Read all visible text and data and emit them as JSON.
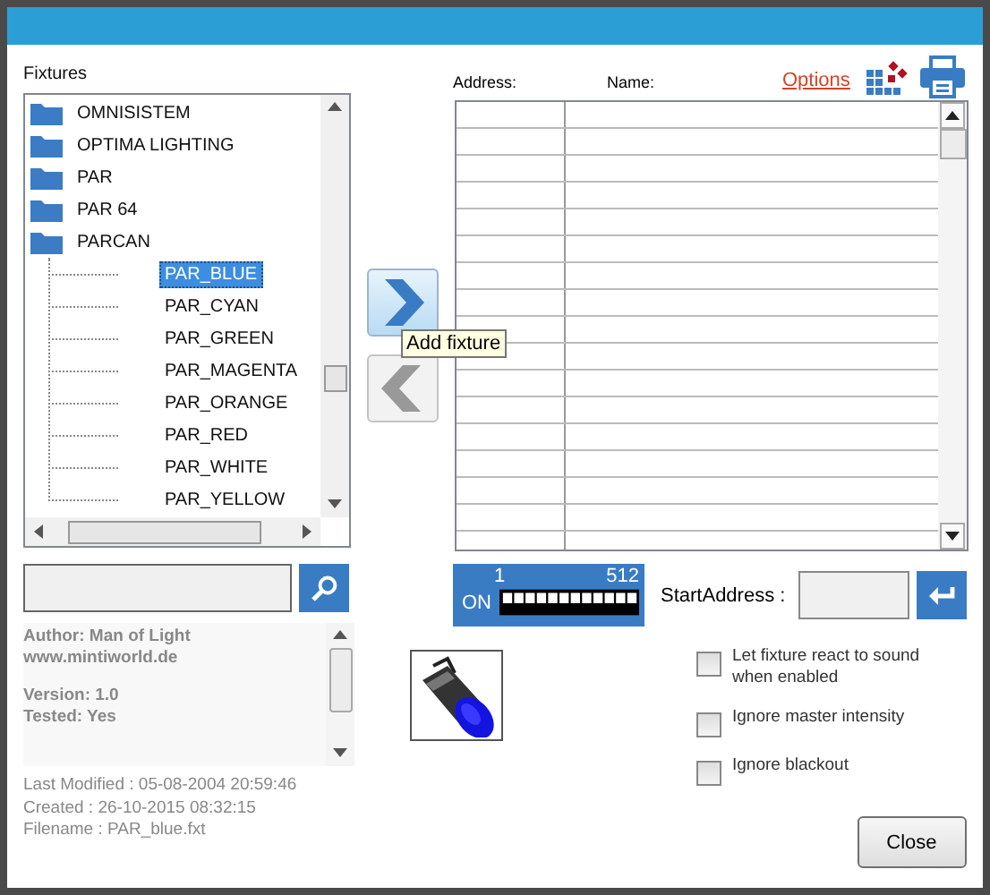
{
  "fixtures_label": "Fixtures",
  "tree": [
    {
      "label": "OMNISISTEM",
      "selected": false
    },
    {
      "label": "OPTIMA LIGHTING",
      "selected": false
    },
    {
      "label": "PAR",
      "selected": false
    },
    {
      "label": "PAR 64",
      "selected": false
    },
    {
      "label": "PARCAN",
      "selected": false,
      "children": [
        {
          "label": "PAR_BLUE",
          "selected": true
        },
        {
          "label": "PAR_CYAN",
          "selected": false
        },
        {
          "label": "PAR_GREEN",
          "selected": false
        },
        {
          "label": "PAR_MAGENTA",
          "selected": false
        },
        {
          "label": "PAR_ORANGE",
          "selected": false
        },
        {
          "label": "PAR_RED",
          "selected": false
        },
        {
          "label": "PAR_WHITE",
          "selected": false
        },
        {
          "label": "PAR_YELLOW",
          "selected": false
        }
      ]
    }
  ],
  "add_button": {
    "tooltip": "Add fixture",
    "disabled": false
  },
  "remove_button": {
    "disabled": true
  },
  "table": {
    "columns": [
      "Address:",
      "Name:"
    ]
  },
  "options_link": "Options",
  "info": [
    [
      "Author: Man of Light",
      "www.mintiworld.de"
    ],
    [
      "Version: 1.0",
      "Tested: Yes"
    ]
  ],
  "file_info": [
    "Last Modified : 05-08-2004 20:59:46",
    "Created : 26-10-2015 08:32:15",
    "Filename : PAR_blue.fxt"
  ],
  "dmx": {
    "start": "1",
    "end": "512",
    "on_label": "ON"
  },
  "start_address": {
    "label": "StartAddress :"
  },
  "checkboxes": [
    {
      "label": "Let fixture react to sound when enabled",
      "checked": false
    },
    {
      "label": "Ignore master intensity",
      "checked": false
    },
    {
      "label": "Ignore blackout",
      "checked": false
    }
  ],
  "close_button": "Close"
}
